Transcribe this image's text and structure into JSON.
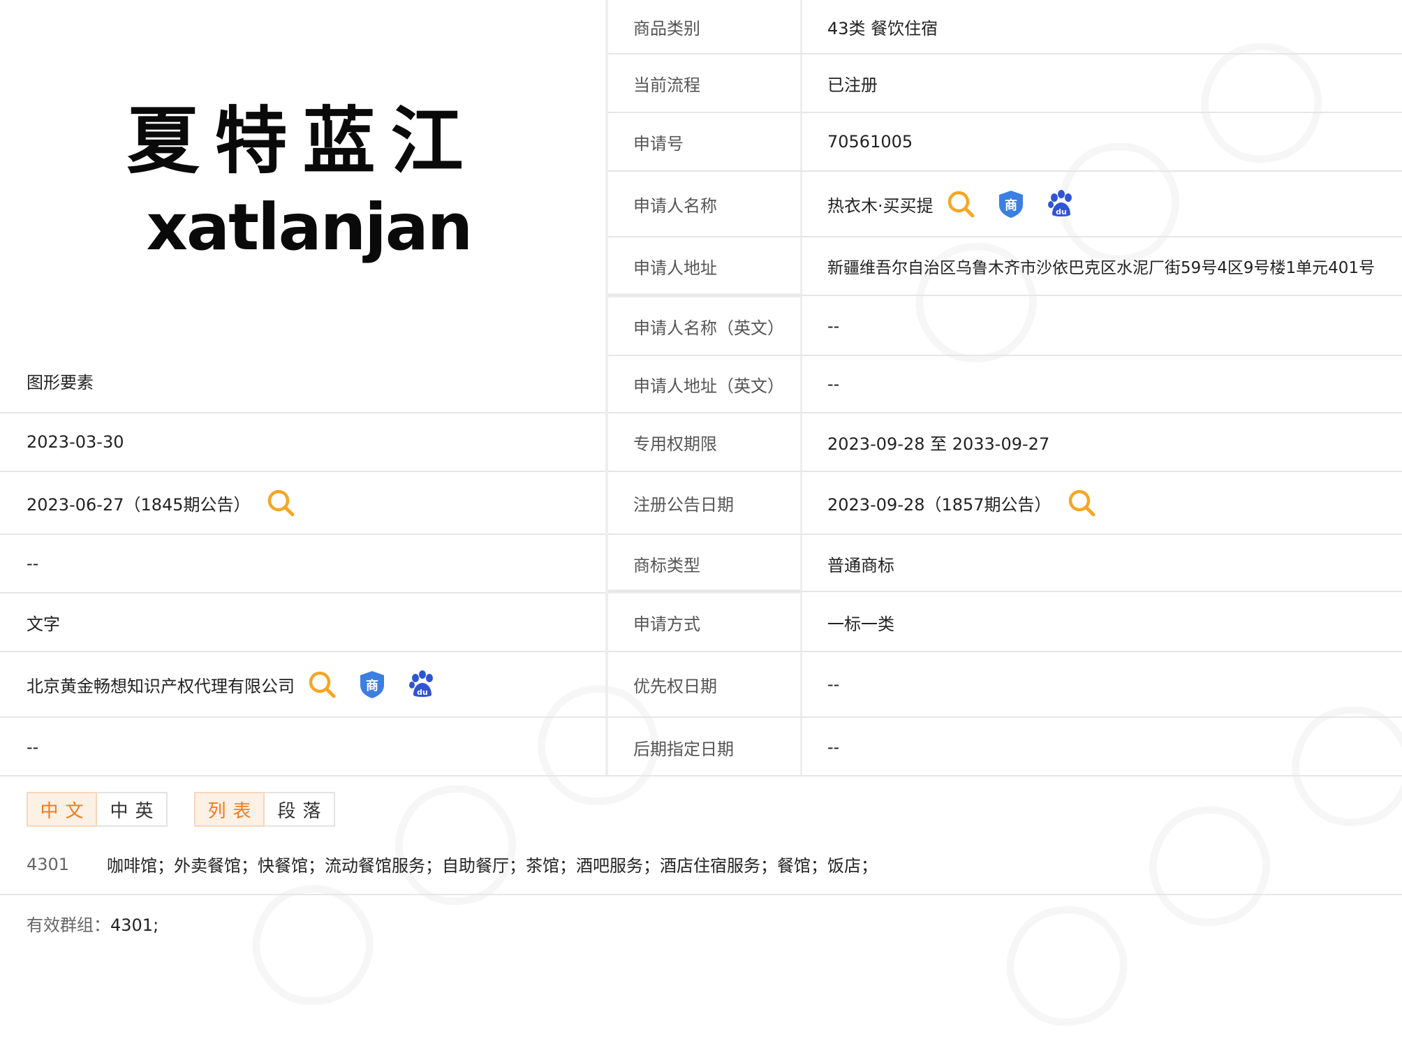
{
  "left": {
    "logo_cn": "夏特蓝江",
    "logo_en": "xatlanjan",
    "graphic_label": "图形要素",
    "apply_date": "2023-03-30",
    "prelim_notice": "2023-06-27（1845期公告）",
    "dash1": "--",
    "mark_form": "文字",
    "agent": "北京黄金畅想知识产权代理有限公司",
    "dash2": "--"
  },
  "right": {
    "rows": [
      {
        "label": "商品类别",
        "value": "43类 餐饮住宿"
      },
      {
        "label": "当前流程",
        "value": "已注册"
      },
      {
        "label": "申请号",
        "value": "70561005"
      },
      {
        "label": "申请人名称",
        "value": "热衣木·买买提"
      },
      {
        "label": "申请人地址",
        "value": "新疆维吾尔自治区乌鲁木齐市沙依巴克区水泥厂街59号4区9号楼1单元401号"
      },
      {
        "label": "申请人名称（英文）",
        "value": "--"
      },
      {
        "label": "申请人地址（英文）",
        "value": "--"
      },
      {
        "label": "专用权期限",
        "value": "2023-09-28 至 2033-09-27"
      },
      {
        "label": "注册公告日期",
        "value": "2023-09-28（1857期公告）"
      },
      {
        "label": "商标类型",
        "value": "普通商标"
      },
      {
        "label": "申请方式",
        "value": "一标一类"
      },
      {
        "label": "优先权日期",
        "value": "--"
      },
      {
        "label": "后期指定日期",
        "value": "--"
      }
    ]
  },
  "tabs": {
    "lang": [
      "中文",
      "中英"
    ],
    "view": [
      "列表",
      "段落"
    ],
    "active_lang": "中文",
    "active_view": "列表"
  },
  "goods": {
    "code": "4301",
    "items": "咖啡馆；外卖餐馆；快餐馆；流动餐馆服务；自助餐厅；茶馆；酒吧服务；酒店住宿服务；餐馆；饭店；"
  },
  "groups": {
    "label": "有效群组：",
    "value": "4301;"
  },
  "icons": [
    "search-icon",
    "trademark-shield-icon",
    "baidu-paw-icon"
  ],
  "colors": {
    "accent": "#f07a1f",
    "search": "#f5a623",
    "shield": "#3b7fe0",
    "baidu": "#2f55d4"
  }
}
